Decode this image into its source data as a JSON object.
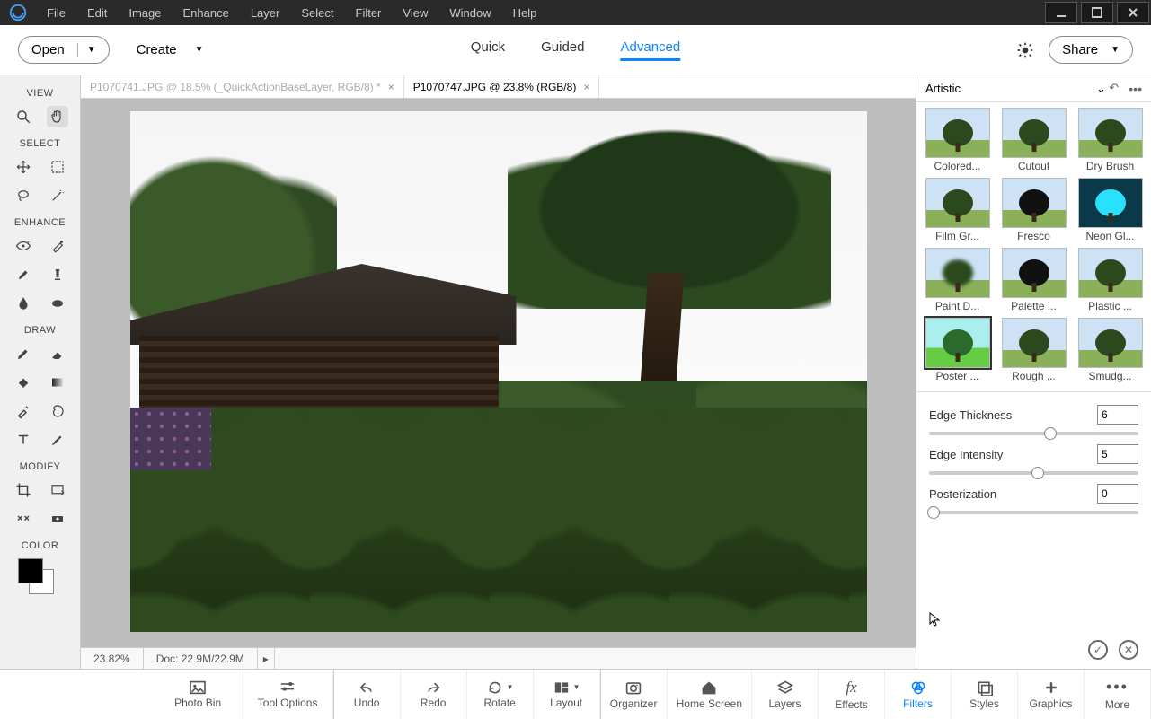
{
  "menubar": [
    "File",
    "Edit",
    "Image",
    "Enhance",
    "Layer",
    "Select",
    "Filter",
    "View",
    "Window",
    "Help"
  ],
  "toolbar": {
    "open": "Open",
    "create": "Create"
  },
  "modes": [
    {
      "label": "Quick",
      "active": false
    },
    {
      "label": "Guided",
      "active": false
    },
    {
      "label": "Advanced",
      "active": true
    }
  ],
  "share": "Share",
  "left_sections": {
    "view": "VIEW",
    "select": "SELECT",
    "enhance": "ENHANCE",
    "draw": "DRAW",
    "modify": "MODIFY",
    "color": "COLOR"
  },
  "doc_tabs": [
    {
      "label": "P1070741.JPG @ 18.5% (_QuickActionBaseLayer, RGB/8) *",
      "active": false
    },
    {
      "label": "P1070747.JPG @ 23.8% (RGB/8)",
      "active": true
    }
  ],
  "statusbar": {
    "zoom": "23.82%",
    "docinfo": "Doc: 22.9M/22.9M"
  },
  "right_panel": {
    "category": "Artistic",
    "filters": [
      {
        "label": "Colored...",
        "cls": ""
      },
      {
        "label": "Cutout",
        "cls": ""
      },
      {
        "label": "Dry Brush",
        "cls": ""
      },
      {
        "label": "Film Gr...",
        "cls": ""
      },
      {
        "label": "Fresco",
        "cls": "palette"
      },
      {
        "label": "Neon Gl...",
        "cls": "neon"
      },
      {
        "label": "Paint D...",
        "cls": "paint"
      },
      {
        "label": "Palette ...",
        "cls": "palette"
      },
      {
        "label": "Plastic ...",
        "cls": ""
      },
      {
        "label": "Poster ...",
        "cls": "poster",
        "selected": true
      },
      {
        "label": "Rough ...",
        "cls": ""
      },
      {
        "label": "Smudg...",
        "cls": ""
      }
    ],
    "sliders": [
      {
        "name": "Edge Thickness",
        "value": "6",
        "pos": 58
      },
      {
        "name": "Edge Intensity",
        "value": "5",
        "pos": 52
      },
      {
        "name": "Posterization",
        "value": "0",
        "pos": 2
      }
    ]
  },
  "bottombar": [
    {
      "label": "Photo Bin",
      "icon": "image"
    },
    {
      "label": "Tool Options",
      "icon": "sliders"
    },
    {
      "label": "Undo",
      "icon": "undo"
    },
    {
      "label": "Redo",
      "icon": "redo"
    },
    {
      "label": "Rotate",
      "icon": "rotate",
      "dd": true
    },
    {
      "label": "Layout",
      "icon": "layout",
      "dd": true
    },
    {
      "label": "Organizer",
      "icon": "organizer"
    },
    {
      "label": "Home Screen",
      "icon": "home"
    },
    {
      "label": "Layers",
      "icon": "layers"
    },
    {
      "label": "Effects",
      "icon": "fx"
    },
    {
      "label": "Filters",
      "icon": "filters",
      "active": true
    },
    {
      "label": "Styles",
      "icon": "styles"
    },
    {
      "label": "Graphics",
      "icon": "plus"
    },
    {
      "label": "More",
      "icon": "more"
    }
  ]
}
